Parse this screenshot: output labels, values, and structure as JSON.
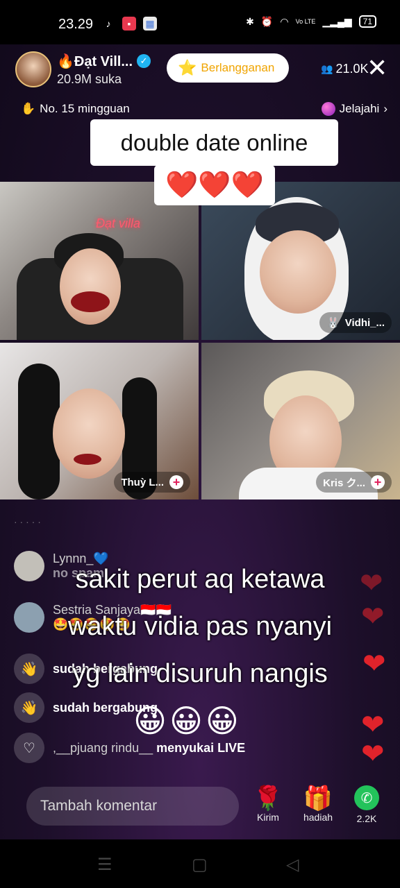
{
  "status_bar": {
    "time": "23.29",
    "battery": "71",
    "volte": "Vo LTE"
  },
  "host": {
    "name": "🔥Đạt Vill...",
    "likes": "20.9M suka"
  },
  "subscribe_label": "Berlangganan",
  "viewer_count": "21.0K",
  "rank_label": "No. 15 mingguan",
  "explore_label": "Jelajahi",
  "sticker": {
    "title": "double date online",
    "hearts": "❤️❤️❤️"
  },
  "tiles": {
    "t1_neon": "Đạt villa",
    "t2_label": "Vidhi_...",
    "t3_label": "Thuỳ L...",
    "t4_label": "Kris ク..."
  },
  "comments": [
    {
      "user": "Lynnn_💙",
      "text": "no spam"
    },
    {
      "user": "Sestria Sanjaya🇮🇩🇮🇩",
      "text": "🤩🤩🤩🤩🤩"
    },
    {
      "user": "",
      "text": "sudah bergabung"
    },
    {
      "user": "",
      "text": "sudah bergabung"
    },
    {
      "user": ",__pjuang rindu__",
      "text": "menyukai LIVE"
    }
  ],
  "caption_lines": [
    "sakit perut aq ketawa",
    "waktu vidia pas nyanyi",
    "yg lain disuruh nangis"
  ],
  "caption_emoji": "😀😀😀",
  "bottom": {
    "comment_placeholder": "Tambah komentar",
    "send_label": "Kirim",
    "gift_label": "hadiah",
    "share_count": "2.2K"
  },
  "icons": {
    "nav": [
      "menu-icon",
      "home-square-icon",
      "back-icon"
    ]
  }
}
